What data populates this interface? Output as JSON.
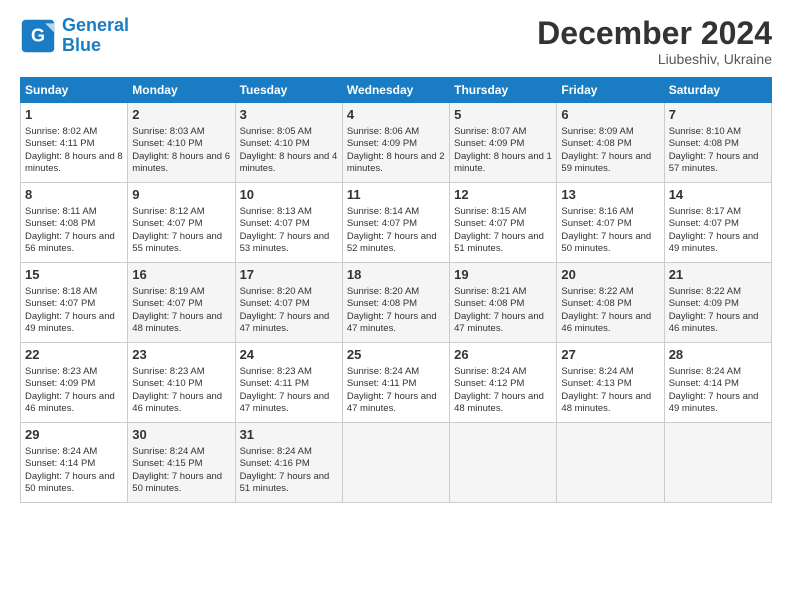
{
  "logo": {
    "line1": "General",
    "line2": "Blue"
  },
  "header": {
    "title": "December 2024",
    "subtitle": "Liubeshiv, Ukraine"
  },
  "weekdays": [
    "Sunday",
    "Monday",
    "Tuesday",
    "Wednesday",
    "Thursday",
    "Friday",
    "Saturday"
  ],
  "weeks": [
    [
      {
        "day": 1,
        "sunrise": "8:02 AM",
        "sunset": "4:11 PM",
        "daylight": "8 hours and 8 minutes."
      },
      {
        "day": 2,
        "sunrise": "8:03 AM",
        "sunset": "4:10 PM",
        "daylight": "8 hours and 6 minutes."
      },
      {
        "day": 3,
        "sunrise": "8:05 AM",
        "sunset": "4:10 PM",
        "daylight": "8 hours and 4 minutes."
      },
      {
        "day": 4,
        "sunrise": "8:06 AM",
        "sunset": "4:09 PM",
        "daylight": "8 hours and 2 minutes."
      },
      {
        "day": 5,
        "sunrise": "8:07 AM",
        "sunset": "4:09 PM",
        "daylight": "8 hours and 1 minute."
      },
      {
        "day": 6,
        "sunrise": "8:09 AM",
        "sunset": "4:08 PM",
        "daylight": "7 hours and 59 minutes."
      },
      {
        "day": 7,
        "sunrise": "8:10 AM",
        "sunset": "4:08 PM",
        "daylight": "7 hours and 57 minutes."
      }
    ],
    [
      {
        "day": 8,
        "sunrise": "8:11 AM",
        "sunset": "4:08 PM",
        "daylight": "7 hours and 56 minutes."
      },
      {
        "day": 9,
        "sunrise": "8:12 AM",
        "sunset": "4:07 PM",
        "daylight": "7 hours and 55 minutes."
      },
      {
        "day": 10,
        "sunrise": "8:13 AM",
        "sunset": "4:07 PM",
        "daylight": "7 hours and 53 minutes."
      },
      {
        "day": 11,
        "sunrise": "8:14 AM",
        "sunset": "4:07 PM",
        "daylight": "7 hours and 52 minutes."
      },
      {
        "day": 12,
        "sunrise": "8:15 AM",
        "sunset": "4:07 PM",
        "daylight": "7 hours and 51 minutes."
      },
      {
        "day": 13,
        "sunrise": "8:16 AM",
        "sunset": "4:07 PM",
        "daylight": "7 hours and 50 minutes."
      },
      {
        "day": 14,
        "sunrise": "8:17 AM",
        "sunset": "4:07 PM",
        "daylight": "7 hours and 49 minutes."
      }
    ],
    [
      {
        "day": 15,
        "sunrise": "8:18 AM",
        "sunset": "4:07 PM",
        "daylight": "7 hours and 49 minutes."
      },
      {
        "day": 16,
        "sunrise": "8:19 AM",
        "sunset": "4:07 PM",
        "daylight": "7 hours and 48 minutes."
      },
      {
        "day": 17,
        "sunrise": "8:20 AM",
        "sunset": "4:07 PM",
        "daylight": "7 hours and 47 minutes."
      },
      {
        "day": 18,
        "sunrise": "8:20 AM",
        "sunset": "4:08 PM",
        "daylight": "7 hours and 47 minutes."
      },
      {
        "day": 19,
        "sunrise": "8:21 AM",
        "sunset": "4:08 PM",
        "daylight": "7 hours and 47 minutes."
      },
      {
        "day": 20,
        "sunrise": "8:22 AM",
        "sunset": "4:08 PM",
        "daylight": "7 hours and 46 minutes."
      },
      {
        "day": 21,
        "sunrise": "8:22 AM",
        "sunset": "4:09 PM",
        "daylight": "7 hours and 46 minutes."
      }
    ],
    [
      {
        "day": 22,
        "sunrise": "8:23 AM",
        "sunset": "4:09 PM",
        "daylight": "7 hours and 46 minutes."
      },
      {
        "day": 23,
        "sunrise": "8:23 AM",
        "sunset": "4:10 PM",
        "daylight": "7 hours and 46 minutes."
      },
      {
        "day": 24,
        "sunrise": "8:23 AM",
        "sunset": "4:11 PM",
        "daylight": "7 hours and 47 minutes."
      },
      {
        "day": 25,
        "sunrise": "8:24 AM",
        "sunset": "4:11 PM",
        "daylight": "7 hours and 47 minutes."
      },
      {
        "day": 26,
        "sunrise": "8:24 AM",
        "sunset": "4:12 PM",
        "daylight": "7 hours and 48 minutes."
      },
      {
        "day": 27,
        "sunrise": "8:24 AM",
        "sunset": "4:13 PM",
        "daylight": "7 hours and 48 minutes."
      },
      {
        "day": 28,
        "sunrise": "8:24 AM",
        "sunset": "4:14 PM",
        "daylight": "7 hours and 49 minutes."
      }
    ],
    [
      {
        "day": 29,
        "sunrise": "8:24 AM",
        "sunset": "4:14 PM",
        "daylight": "7 hours and 50 minutes."
      },
      {
        "day": 30,
        "sunrise": "8:24 AM",
        "sunset": "4:15 PM",
        "daylight": "7 hours and 50 minutes."
      },
      {
        "day": 31,
        "sunrise": "8:24 AM",
        "sunset": "4:16 PM",
        "daylight": "7 hours and 51 minutes."
      },
      null,
      null,
      null,
      null
    ]
  ]
}
